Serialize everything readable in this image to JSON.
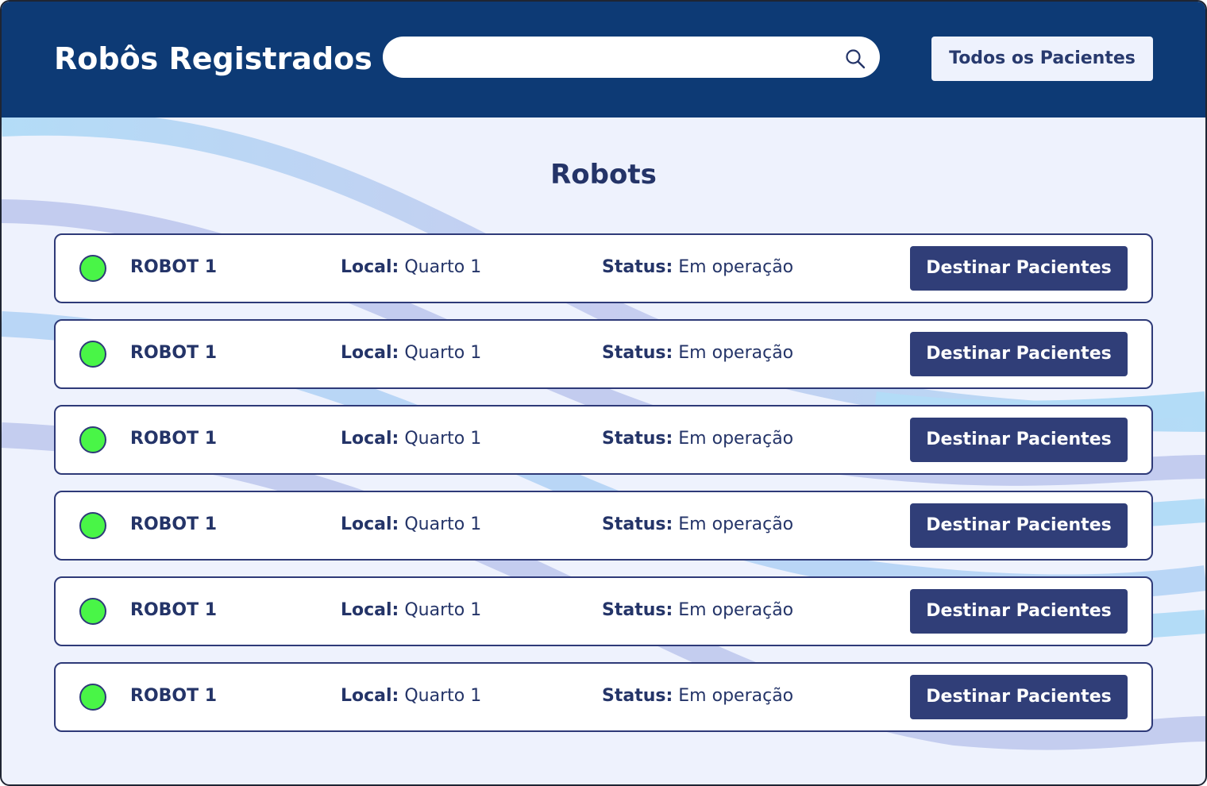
{
  "header": {
    "title": "Robôs Registrados",
    "search": {
      "value": "",
      "placeholder": ""
    },
    "all_patients_label": "Todos os Pacientes"
  },
  "main": {
    "section_title": "Robots",
    "robots": [
      {
        "name": "ROBOT 1",
        "local_label": "Local:",
        "local_value": "Quarto 1",
        "status_label": "Status:",
        "status_value": "Em operação",
        "action_label": "Destinar Pacientes"
      },
      {
        "name": "ROBOT 1",
        "local_label": "Local:",
        "local_value": "Quarto 1",
        "status_label": "Status:",
        "status_value": "Em operação",
        "action_label": "Destinar Pacientes"
      },
      {
        "name": "ROBOT 1",
        "local_label": "Local:",
        "local_value": "Quarto 1",
        "status_label": "Status:",
        "status_value": "Em operação",
        "action_label": "Destinar Pacientes"
      },
      {
        "name": "ROBOT 1",
        "local_label": "Local:",
        "local_value": "Quarto 1",
        "status_label": "Status:",
        "status_value": "Em operação",
        "action_label": "Destinar Pacientes"
      },
      {
        "name": "ROBOT 1",
        "local_label": "Local:",
        "local_value": "Quarto 1",
        "status_label": "Status:",
        "status_value": "Em operação",
        "action_label": "Destinar Pacientes"
      },
      {
        "name": "ROBOT 1",
        "local_label": "Local:",
        "local_value": "Quarto 1",
        "status_label": "Status:",
        "status_value": "Em operação",
        "action_label": "Destinar Pacientes"
      }
    ]
  },
  "icons": {
    "search": "search-icon",
    "status": "status-dot-icon"
  },
  "colors": {
    "header_bg": "#0d3a75",
    "page_bg": "#eef2fd",
    "accent": "#303e78",
    "status_ok": "#49f547",
    "text": "#243468"
  }
}
